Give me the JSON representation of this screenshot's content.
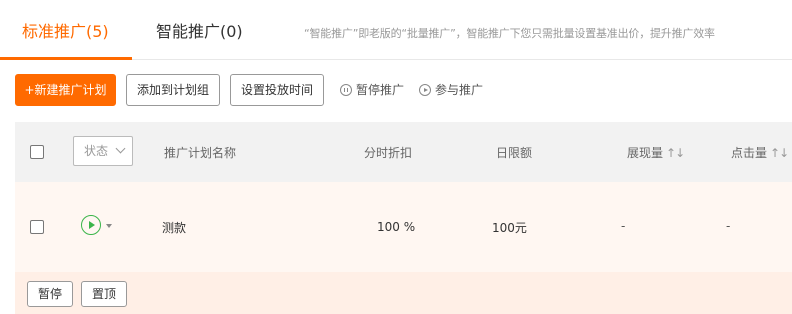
{
  "tabs": [
    {
      "label": "标准推广(5)"
    },
    {
      "label": "智能推广(0)"
    }
  ],
  "tab_description": "“智能推广”即老版的“批量推广”，智能推广下您只需批量设置基准出价，提升推广效率",
  "toolbar": {
    "new_plan": "+新建推广计划",
    "add_to_group": "添加到计划组",
    "set_time": "设置投放时间",
    "pause": "暂停推广",
    "join": "参与推广"
  },
  "table": {
    "headers": {
      "status": "状态",
      "plan_name": "推广计划名称",
      "time_discount": "分时折扣",
      "daily_limit": "日限额",
      "impressions": "展现量",
      "clicks": "点击量"
    },
    "rows": [
      {
        "plan_name": "测款",
        "time_discount": "100 %",
        "daily_limit": "100元",
        "impressions": "-",
        "clicks": "-"
      }
    ]
  },
  "footer": {
    "pause": "暂停",
    "pin_top": "置顶"
  },
  "colors": {
    "accent": "#ff6a00",
    "status_active": "#3bb54a"
  },
  "icons": {
    "pause": "pause-circle-icon",
    "join": "play-circle-icon",
    "sort": "sort-icon",
    "status": "play-circle-icon"
  }
}
